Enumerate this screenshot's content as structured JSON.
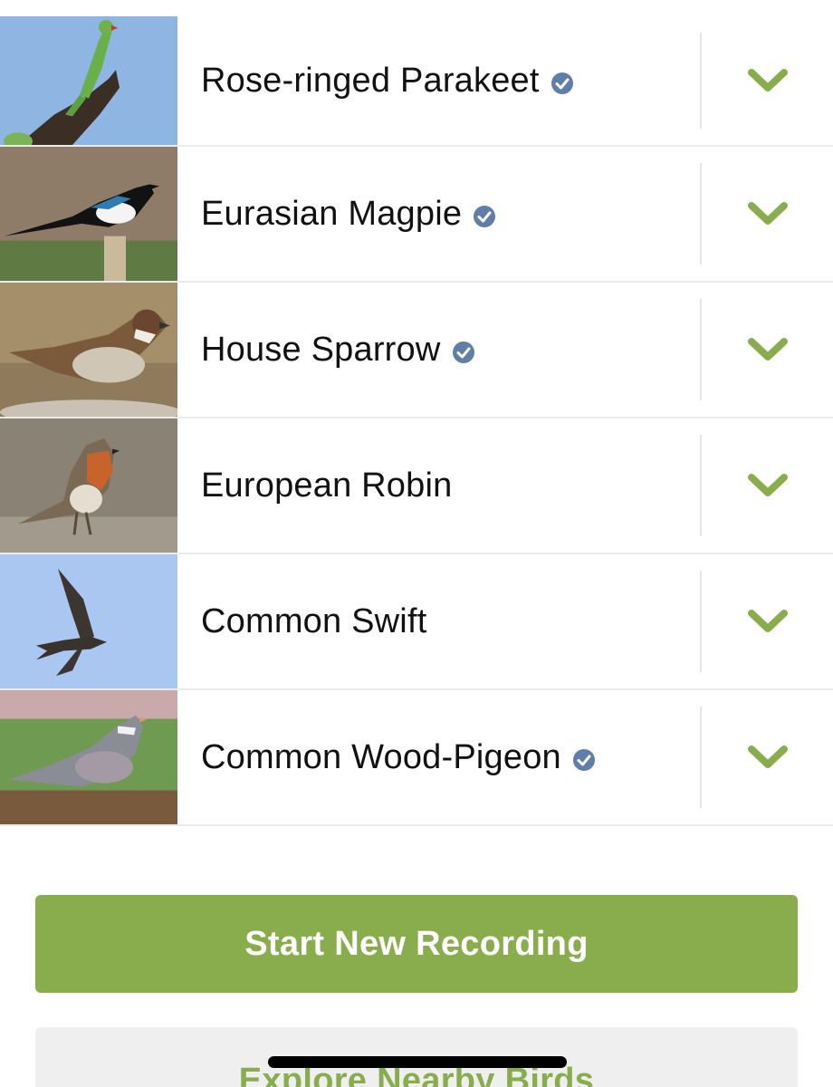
{
  "birds": [
    {
      "name": "Rose-ringed Parakeet",
      "verified": true,
      "thumb": "rose-ringed-parakeet-photo"
    },
    {
      "name": "Eurasian Magpie",
      "verified": true,
      "thumb": "eurasian-magpie-photo"
    },
    {
      "name": "House Sparrow",
      "verified": true,
      "thumb": "house-sparrow-photo"
    },
    {
      "name": "European Robin",
      "verified": false,
      "thumb": "european-robin-photo"
    },
    {
      "name": "Common Swift",
      "verified": false,
      "thumb": "common-swift-photo"
    },
    {
      "name": "Common Wood-Pigeon",
      "verified": true,
      "thumb": "common-wood-pigeon-photo"
    }
  ],
  "icons": {
    "verified": "verified-check-icon",
    "expand": "chevron-down-icon"
  },
  "actions": {
    "primary_label": "Start New Recording",
    "secondary_label": "Explore Nearby Birds"
  },
  "colors": {
    "accent_green": "#89ad4d",
    "verified_blue": "#5f7ea8",
    "secondary_bg": "#efefef"
  }
}
